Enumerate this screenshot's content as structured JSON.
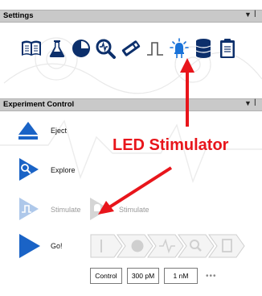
{
  "settings_panel": {
    "title": "Settings",
    "icons": [
      "book-icon",
      "flask-icon",
      "pie-icon",
      "magnifier-wave-icon",
      "stimulus-pen-icon",
      "pulse-wave-icon",
      "led-icon",
      "database-icon",
      "clipboard-icon"
    ]
  },
  "experiment_panel": {
    "title": "Experiment Control",
    "eject_label": "Eject",
    "explore_label": "Explore",
    "stimulate_label": "Stimulate",
    "stimulate_led_label": "Stimulate",
    "go_label": "Go!",
    "concentrations": [
      "Control",
      "300 pM",
      "1 nM"
    ],
    "more_label": "•••"
  },
  "annotation": {
    "text": "LED Stimulator",
    "color": "#e8151b"
  },
  "colors": {
    "accent_blue": "#1a63c6",
    "header_bg": "#c9c9c9",
    "arrow_red": "#e8151b"
  }
}
